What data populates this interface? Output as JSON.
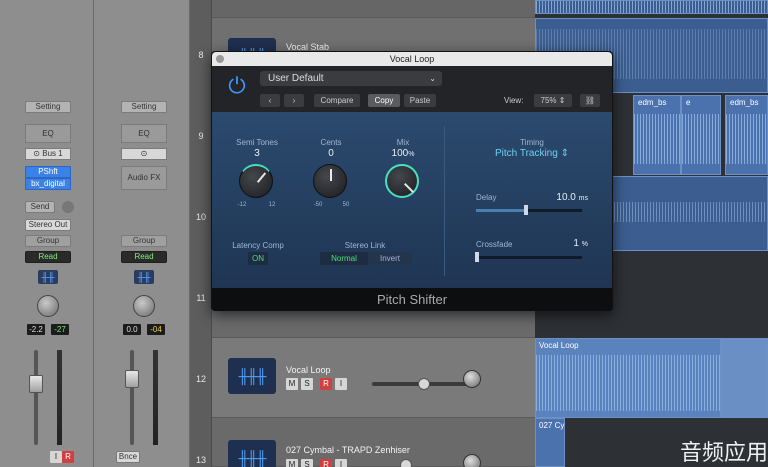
{
  "mixer": {
    "strip1": {
      "setting": "Setting",
      "eq": "EQ",
      "bus": "Bus 1",
      "plugin_line1": "PShft",
      "plugin_line2": "bx_digital",
      "send": "Send",
      "output": "Stereo Out",
      "group": "Group",
      "automation": "Read",
      "value1": "-2.2",
      "value2": "-27",
      "i_label": "I",
      "r_label": "R"
    },
    "strip2": {
      "setting": "Setting",
      "eq": "EQ",
      "plugin": "Audio FX",
      "group": "Group",
      "automation": "Read",
      "value1": "0.0",
      "value2": "-04",
      "name": "Bnce"
    }
  },
  "tracks": [
    {
      "number": "8",
      "name": "Vocal Stab"
    },
    {
      "number": "9",
      "name": ""
    },
    {
      "number": "10",
      "name": ""
    },
    {
      "number": "11",
      "name": ""
    },
    {
      "number": "12",
      "name": "Vocal Loop",
      "m": "M",
      "s": "S",
      "r": "R",
      "i": "I"
    },
    {
      "number": "13",
      "name": "027 Cymbal - TRAPD Zenhiser",
      "m": "M",
      "s": "S",
      "r": "R",
      "i": "I"
    }
  ],
  "regions": {
    "r1": "edm_bs",
    "r2": "e",
    "r3": "edm_bs",
    "r4": "Vocal Loop",
    "r5": "027 Cy"
  },
  "plugin": {
    "window_title": "Vocal Loop",
    "preset": "User Default",
    "compare": "Compare",
    "copy": "Copy",
    "paste": "Paste",
    "view_label": "View:",
    "zoom": "75%",
    "semitones": {
      "label": "Semi Tones",
      "value": "3",
      "min": "-12",
      "max": "12"
    },
    "cents": {
      "label": "Cents",
      "value": "0",
      "min": "-50",
      "max": "50"
    },
    "mix": {
      "label": "Mix",
      "value": "100",
      "unit": "%",
      "level": 1.0
    },
    "timing": {
      "label": "Timing",
      "value": "Pitch Tracking"
    },
    "delay": {
      "label": "Delay",
      "value": "10.0",
      "unit": "ms",
      "level": 0.47
    },
    "crossfade": {
      "label": "Crossfade",
      "value": "1",
      "unit": "%",
      "level": 0.01
    },
    "latency": {
      "label": "Latency Comp",
      "value": "ON"
    },
    "stereo_link": {
      "label": "Stereo Link",
      "opt1": "Normal",
      "opt2": "Invert"
    },
    "footer": "Pitch Shifter"
  },
  "watermark": "音频应用"
}
